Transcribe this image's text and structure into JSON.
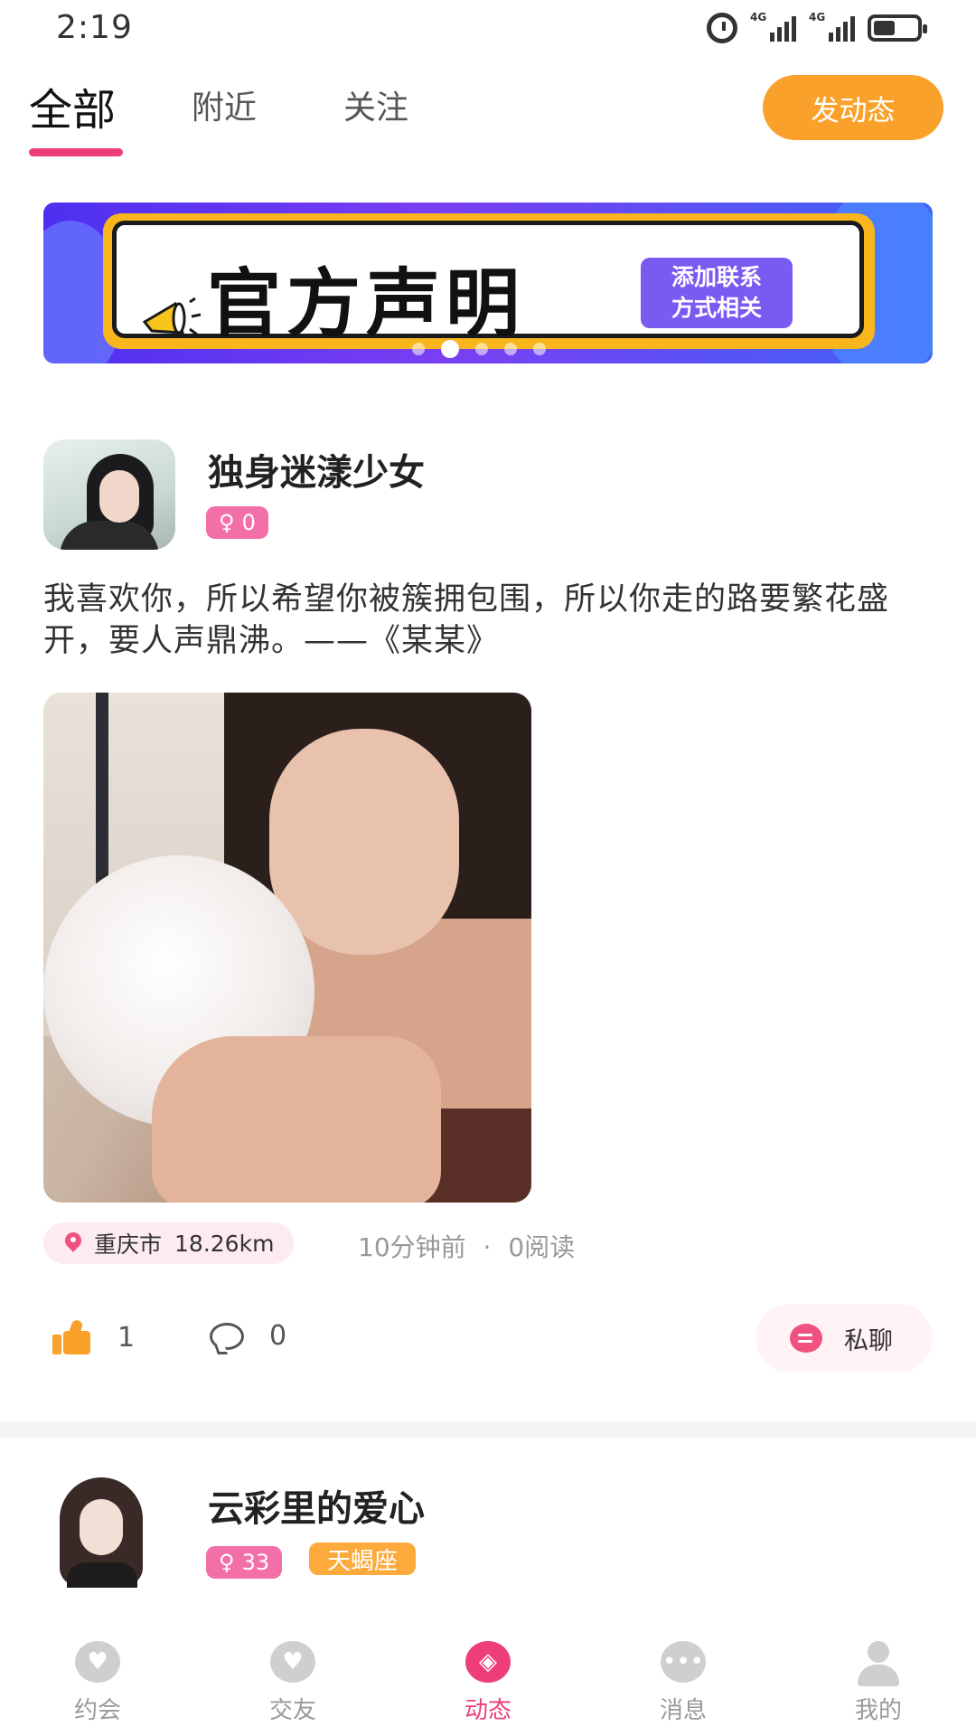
{
  "status_bar": {
    "time": "2:19",
    "network_1": "4G",
    "network_2": "4G",
    "battery_level": 0.5
  },
  "top_tabs": {
    "items": [
      {
        "label": "全部",
        "active": true
      },
      {
        "label": "附近",
        "active": false
      },
      {
        "label": "关注",
        "active": false
      }
    ],
    "post_button_label": "发动态"
  },
  "banner": {
    "title": "官方声明",
    "subtitle_line1": "添加联系",
    "subtitle_line2": "方式相关",
    "slide_count": 5,
    "active_slide": 2
  },
  "posts": [
    {
      "username": "独身迷漾少女",
      "gender_symbol": "♀",
      "age": "0",
      "text": "我喜欢你，所以希望你被簇拥包围，所以你走的路要繁花盛开，要人声鼎沸。——《某某》",
      "location_city": "重庆市",
      "distance": "18.26km",
      "time_ago": "10分钟前",
      "separator": "·",
      "reads": "0阅读",
      "likes": "1",
      "comments": "0",
      "chat_label": "私聊"
    },
    {
      "username": "云彩里的爱心",
      "gender_symbol": "♀",
      "age": "33",
      "zodiac": "天蝎座"
    }
  ],
  "bottom_nav": {
    "items": [
      {
        "label": "约会",
        "icon": "hearts-icon",
        "active": false
      },
      {
        "label": "交友",
        "icon": "heart-bubble-icon",
        "active": false
      },
      {
        "label": "动态",
        "icon": "compass-icon",
        "active": true
      },
      {
        "label": "消息",
        "icon": "message-icon",
        "active": false
      },
      {
        "label": "我的",
        "icon": "profile-icon",
        "active": false
      }
    ]
  },
  "colors": {
    "accent_pink": "#ee3d7b",
    "accent_orange": "#f9a12a",
    "badge_pink": "#f36fa8",
    "badge_orange": "#fbaa3b"
  }
}
